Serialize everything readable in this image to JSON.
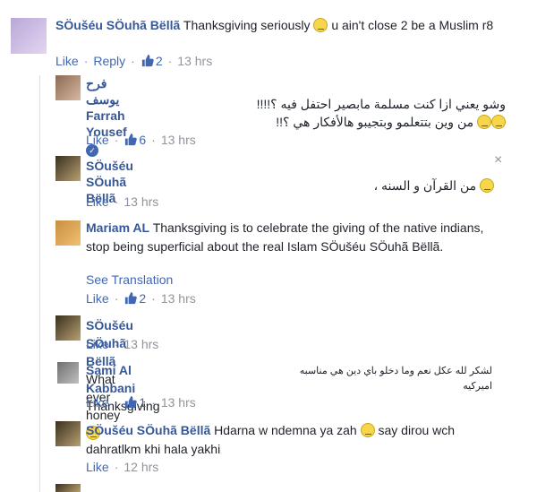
{
  "comments": [
    {
      "author": "SÖušéu SÖuhã Bëllã",
      "text": "Thanksgiving seriously",
      "text_after": "u ain't close 2 be a Muslim r8",
      "like": "Like",
      "reply": "Reply",
      "likes": "2",
      "time": "13 hrs"
    },
    {
      "author_ar": "فرح يوسف",
      "author": "Farrah Yousef",
      "text_line1": "وشو يعني ازا كنت مسلمة مابصير احتفل فيه ؟!!!!",
      "text_line2": "من وين بتتعلمو وبتجيبو هالأفكار هي ؟!!",
      "like": "Like",
      "likes": "6",
      "time": "13 hrs"
    },
    {
      "author": "SÖušéu SÖuhã Bëllã",
      "text": "من القرآن و السنه ،",
      "like": "Like",
      "time": "13 hrs"
    },
    {
      "author": "Mariam AL",
      "text": "Thanksgiving is to celebrate the giving of the native indians, stop being superficial about the real Islam SÖušéu SÖuhã Bëllã.",
      "see_translation": "See Translation",
      "like": "Like",
      "likes": "2",
      "time": "13 hrs"
    },
    {
      "author": "SÖušéu SÖuhã Bëllã",
      "text": "What ever honey",
      "like": "Like",
      "time": "13 hrs"
    },
    {
      "author": "Sami Al Kabbani",
      "text": "Thanksgiving",
      "text_ar": "لشكر لله عكل نعم وما دخلو باي دين هي مناسبه اميركيه",
      "like": "Like",
      "likes": "1",
      "time": "13 hrs"
    },
    {
      "author": "SÖušéu SÖuhã Bëllã",
      "text": "Hdarna w ndemna ya zah",
      "text_after": "say dirou wch dahratlkm khi hala yakhi",
      "like": "Like",
      "time": "12 hrs"
    }
  ],
  "close_symbol": "×"
}
